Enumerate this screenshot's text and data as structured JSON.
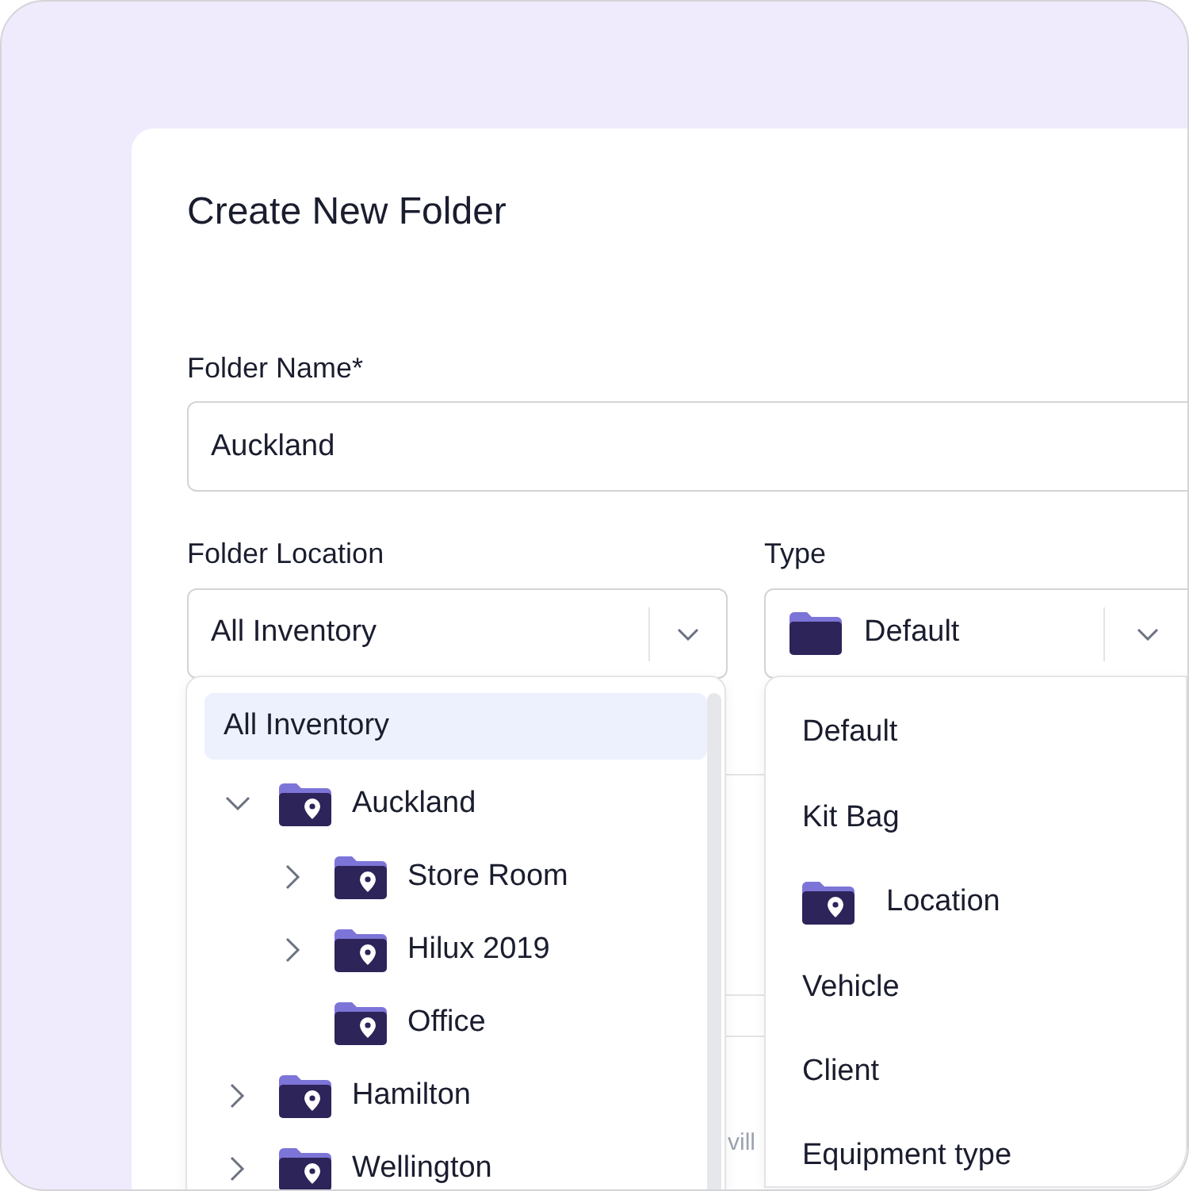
{
  "dialog": {
    "title": "Create New Folder"
  },
  "folder_name": {
    "label": "Folder Name*",
    "value": "Auckland"
  },
  "folder_location": {
    "label": "Folder Location",
    "value": "All Inventory"
  },
  "type": {
    "label": "Type",
    "value": "Default"
  },
  "background_text": "vill",
  "location_menu": {
    "items": [
      {
        "label": "All Inventory",
        "selected": true,
        "children": [
          {
            "label": "Auckland",
            "selected": false,
            "expandable": true,
            "expanded": true,
            "children": [
              {
                "label": "Store Room",
                "selected": false,
                "expandable": true,
                "expanded": false
              },
              {
                "label": "Hilux 2019",
                "selected": false,
                "expandable": true,
                "expanded": false
              },
              {
                "label": "Office",
                "selected": false,
                "expandable": false
              }
            ]
          },
          {
            "label": "Hamilton",
            "selected": false,
            "expandable": true,
            "expanded": false
          },
          {
            "label": "Wellington",
            "selected": false,
            "expandable": true,
            "expanded": false
          }
        ]
      }
    ]
  },
  "type_menu": {
    "items": [
      {
        "label": "Default",
        "kind": "text"
      },
      {
        "label": "Kit Bag",
        "kind": "text"
      },
      {
        "label": "Location",
        "kind": "icon"
      },
      {
        "label": "Vehicle",
        "kind": "text"
      },
      {
        "label": "Client",
        "kind": "text"
      },
      {
        "label": "Equipment type",
        "kind": "text"
      }
    ]
  }
}
